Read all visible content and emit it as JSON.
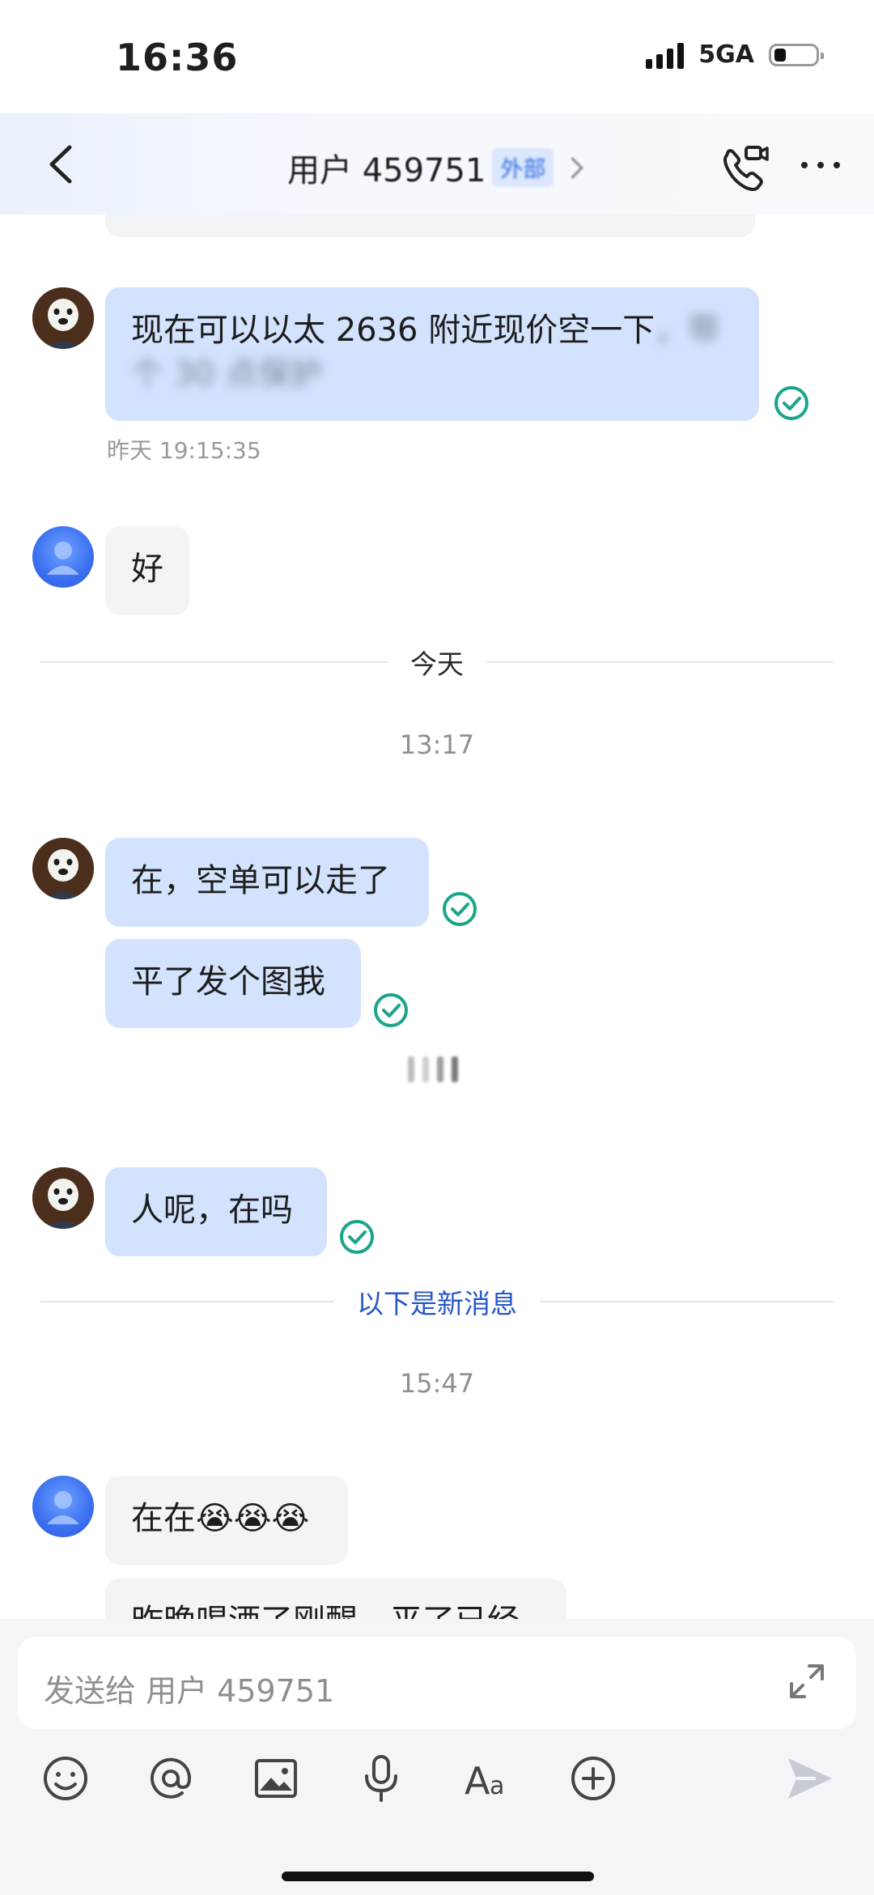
{
  "status_bar": {
    "time": "16:36",
    "network": "5GA"
  },
  "header": {
    "title": "用户 459751",
    "tag": "外部"
  },
  "messages": {
    "m1_text_clear": "现在可以以太 2636 附近现价空一下",
    "m1_text_blur_tail": "，带",
    "m1_text_line2": "个 30 点保护",
    "m1_time": "昨天 19:15:35",
    "m2_text": "好",
    "divider_today": "今天",
    "time_1317": "13:17",
    "m3_text": "在，空单可以走了",
    "m4_text": "平了发个图我",
    "m5_text": "人呢，在吗",
    "divider_new": "以下是新消息",
    "time_1547": "15:47",
    "m6_text": "在在😭😭😭",
    "m7_text": "昨晚喝酒了刚醒，平了已经"
  },
  "input": {
    "placeholder": "发送给 用户 459751"
  },
  "colors": {
    "my_bubble": "#d3e3fd",
    "their_bubble": "#f3f4f6",
    "check": "#1aa58a",
    "new_divider": "#2757c9"
  }
}
